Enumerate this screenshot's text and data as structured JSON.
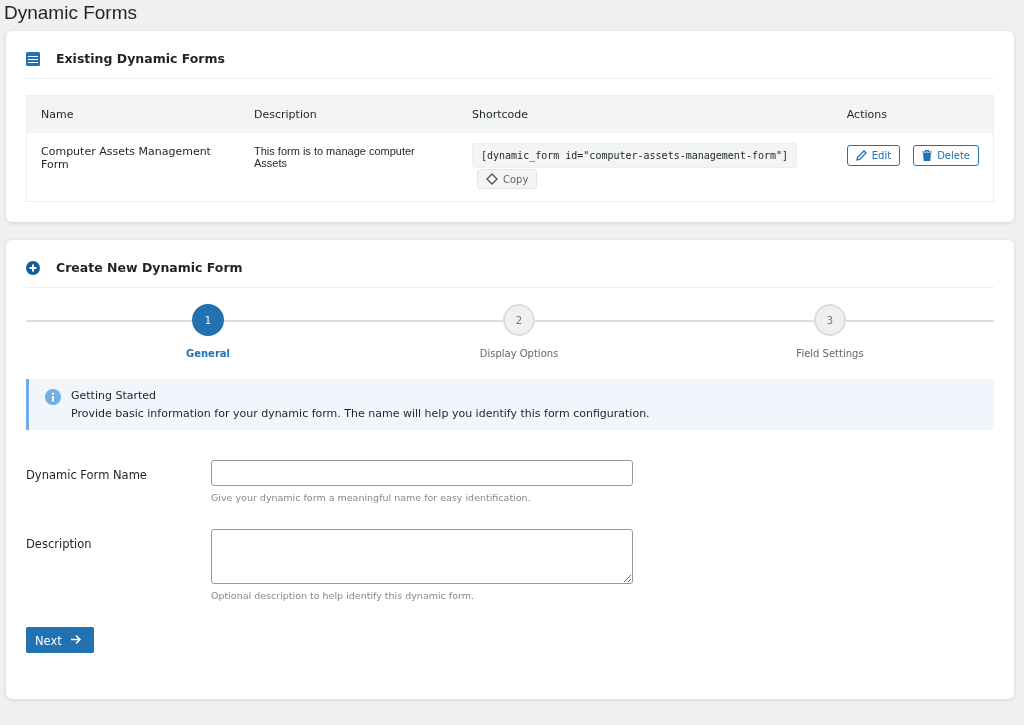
{
  "page_title": "Dynamic Forms",
  "existing": {
    "title": "Existing Dynamic Forms",
    "columns": [
      "Name",
      "Description",
      "Shortcode",
      "Actions"
    ],
    "rows": [
      {
        "name": "Computer Assets Management Form",
        "description": "This form is to manage computer Assets",
        "shortcode": "[dynamic_form id=\"computer-assets-management-form\"]",
        "copy": "Copy",
        "edit": "Edit",
        "delete": "Delete"
      }
    ]
  },
  "create": {
    "title": "Create New Dynamic Form",
    "steps": [
      {
        "number": "1",
        "label": "General",
        "selected": true
      },
      {
        "number": "2",
        "label": "Display Options",
        "selected": false
      },
      {
        "number": "3",
        "label": "Field Settings",
        "selected": false
      }
    ],
    "notice": {
      "title": "Getting Started",
      "text": "Provide basic information for your dynamic form. The name will help you identify this form configuration."
    },
    "fields": [
      {
        "kind": "text",
        "label": "Dynamic Form Name",
        "help": "Give your dynamic form a meaningful name for easy identification."
      },
      {
        "kind": "textarea",
        "label": "Description",
        "help": "Optional description to help identify this dynamic form."
      }
    ],
    "next": "Next"
  }
}
